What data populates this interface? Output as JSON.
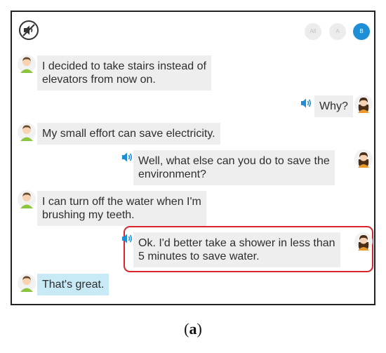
{
  "toolbar": {
    "mute_icon": "speaker-muted-icon",
    "filters": [
      {
        "label": "All",
        "active": false
      },
      {
        "label": "A",
        "active": false
      },
      {
        "label": "B",
        "active": true
      }
    ]
  },
  "messages": [
    {
      "speaker": "A",
      "lines": [
        "I decided to take stairs instead of",
        "elevators from now on."
      ]
    },
    {
      "speaker": "B",
      "lines": [
        "Why?"
      ],
      "audio": true
    },
    {
      "speaker": "A",
      "lines": [
        "My small effort can save electricity."
      ]
    },
    {
      "speaker": "B",
      "lines": [
        "Well, what else can you do to save the",
        "environment?"
      ],
      "audio": true
    },
    {
      "speaker": "A",
      "lines": [
        "I can turn off the water when I'm",
        "brushing my teeth."
      ]
    },
    {
      "speaker": "B",
      "lines": [
        "Ok. I'd better take a shower in less than",
        "5 minutes to save water."
      ],
      "audio": true,
      "highlighted_box": true
    },
    {
      "speaker": "A",
      "lines": [
        "That's great."
      ],
      "selected": true
    }
  ],
  "colors": {
    "accent": "#1e8fd6",
    "bubble": "#eeeeee",
    "selected_bubble": "#c8e9f6",
    "highlight_border": "#d9252b"
  },
  "caption": {
    "open": "(",
    "letter": "a",
    "close": ")"
  }
}
